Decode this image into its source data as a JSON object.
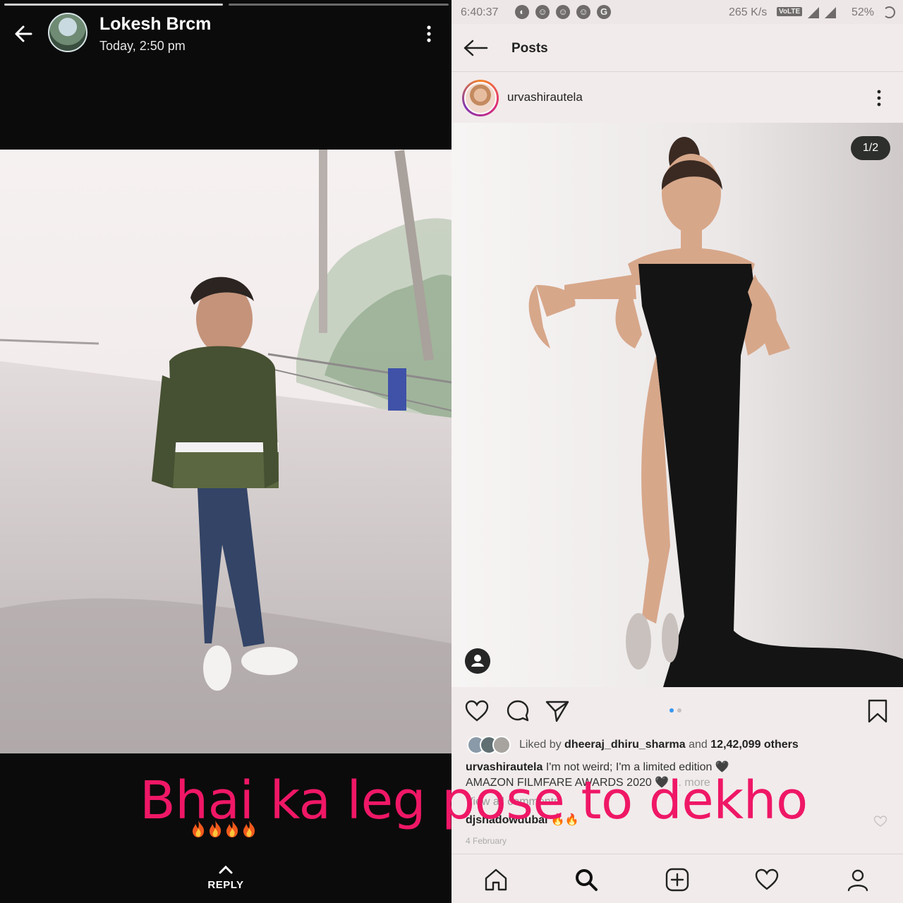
{
  "status_view": {
    "contact_name": "Lokesh Brcm",
    "timestamp": "Today, 2:50 pm",
    "reply_label": "REPLY",
    "back_icon": "arrow-left-icon",
    "menu_icon": "more-vertical-icon"
  },
  "phone_status_bar": {
    "time": "6:40:37",
    "network_speed": "265 K/s",
    "volte_label": "VoLTE",
    "battery": "52%"
  },
  "instagram": {
    "header_title": "Posts",
    "username": "urvashirautela",
    "image_counter": "1/2",
    "liked_by_prefix": "Liked by",
    "liked_by_user": "dheeraj_dhiru_sharma",
    "liked_by_and": "and",
    "liked_by_others": "12,42,099 others",
    "caption_user": "urvashirautela",
    "caption_line1": "I'm not weird; I'm a limited edition 🖤",
    "caption_line2": "AMAZON FILMFARE AWARDS 2020 🖤",
    "caption_more": "... more",
    "view_comments": "View all comments",
    "comment_user": "djshadowdubai",
    "comment_text": "🔥🔥",
    "post_date": "4 February",
    "accent_color": "#3897f0"
  },
  "overlay": {
    "caption": "Bhai ka leg pose to dekho",
    "caption_color": "#ef1766",
    "emoji_count": 4
  }
}
